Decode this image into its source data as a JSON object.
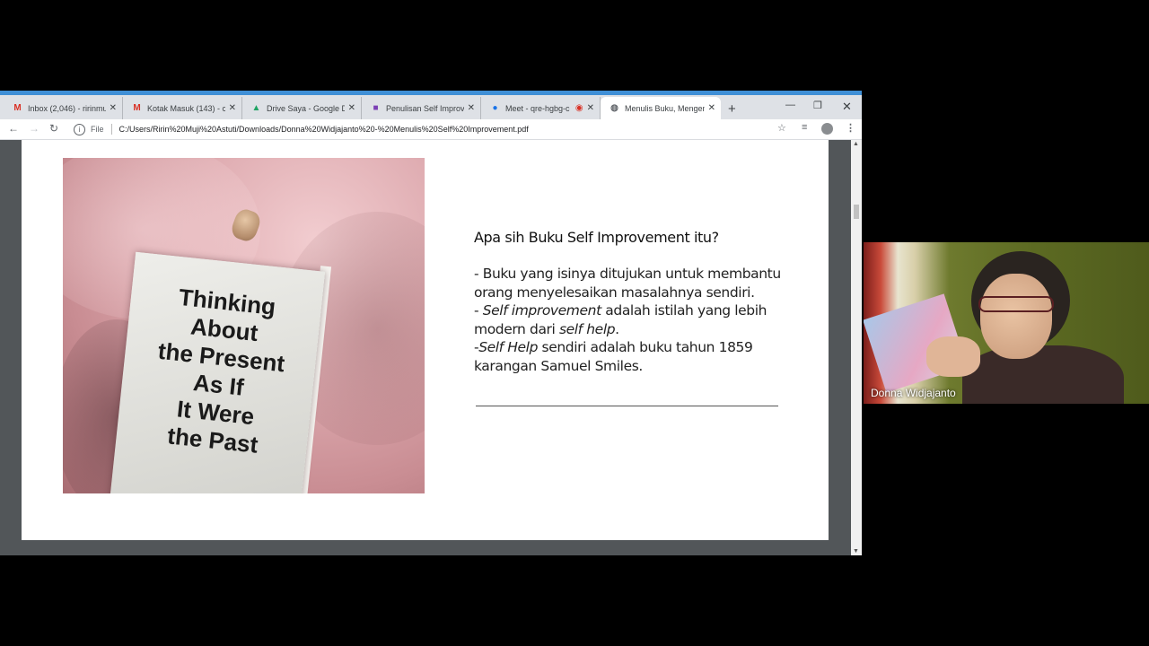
{
  "tabs": [
    {
      "icon": "gmail-icon",
      "icon_glyph": "M",
      "icon_color": "#d93025",
      "title": "Inbox (2,046) - ririnmuji"
    },
    {
      "icon": "gmail-icon",
      "icon_glyph": "M",
      "icon_color": "#d93025",
      "title": "Kotak Masuk (143) - cla"
    },
    {
      "icon": "google-drive-icon",
      "icon_glyph": "▲",
      "icon_color": "#1fa463",
      "title": "Drive Saya - Google Dr"
    },
    {
      "icon": "classroom-icon",
      "icon_glyph": "■",
      "icon_color": "#7b3fb5",
      "title": "Penulisan Self Improve"
    },
    {
      "icon": "meet-icon",
      "icon_glyph": "●",
      "icon_color": "#1a73e8",
      "title": "Meet - qre-hgbg-c"
    },
    {
      "icon": "globe-icon",
      "icon_glyph": "◍",
      "icon_color": "#5f6368",
      "title": "Menulis Buku, Mengem"
    }
  ],
  "address_bar": {
    "scheme_label": "File",
    "url": "C:/Users/Ririn%20Muji%20Astuti/Downloads/Donna%20Widjajanto%20-%20Menulis%20Self%20Improvement.pdf"
  },
  "slide": {
    "book_cover_text": [
      "Thinking",
      "About",
      "the Present",
      "As If",
      "It Were",
      "the Past"
    ],
    "heading": "Apa sih Buku Self Improvement itu?",
    "line1": "- Buku yang isinya ditujukan untuk membantu orang menyelesaikan masalahnya sendiri.",
    "line2_prefix": "- ",
    "line2_italic": "Self improvement",
    "line2_mid": " adalah istilah yang lebih modern dari ",
    "line2_italic2": "self help",
    "line2_suffix": ".",
    "line3_prefix": "-",
    "line3_italic": "Self Help",
    "line3_rest": " sendiri adalah buku tahun 1859 karangan Samuel Smiles."
  },
  "video": {
    "participant_name": "Donna Widjajanto"
  },
  "colors": {
    "accent": "#3f8fd6",
    "tab_bar": "#dee1e6"
  }
}
